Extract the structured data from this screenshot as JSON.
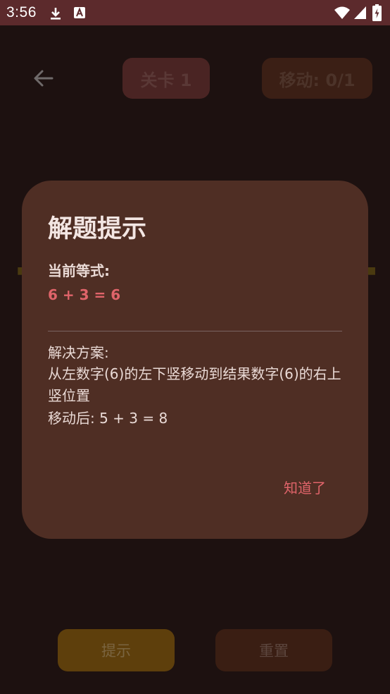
{
  "status_bar": {
    "time": "3:56",
    "icons": [
      "download-icon",
      "text-a-icon",
      "wifi-icon",
      "signal-icon",
      "battery-icon"
    ]
  },
  "header": {
    "back_icon": "arrow-left-icon",
    "level_label": "关卡 1",
    "moves_label": "移动: 0/1"
  },
  "dialog": {
    "title": "解题提示",
    "equation_label": "当前等式:",
    "equation_value": "6 + 3 = 6",
    "solution_label": "解决方案:",
    "solution_text": "从左数字(6)的左下竖移动到结果数字(6)的右上竖位置",
    "after_move": "移动后: 5 + 3 = 8",
    "ok_button": "知道了"
  },
  "footer": {
    "hint_button": "提示",
    "reset_button": "重置"
  },
  "colors": {
    "status_bar": "#5c2a2c",
    "background": "#1d1110",
    "dialog": "#4f2e24",
    "accent": "#e0646a",
    "hint_button": "#5e3f0c",
    "reset_button": "#3a1e13"
  }
}
